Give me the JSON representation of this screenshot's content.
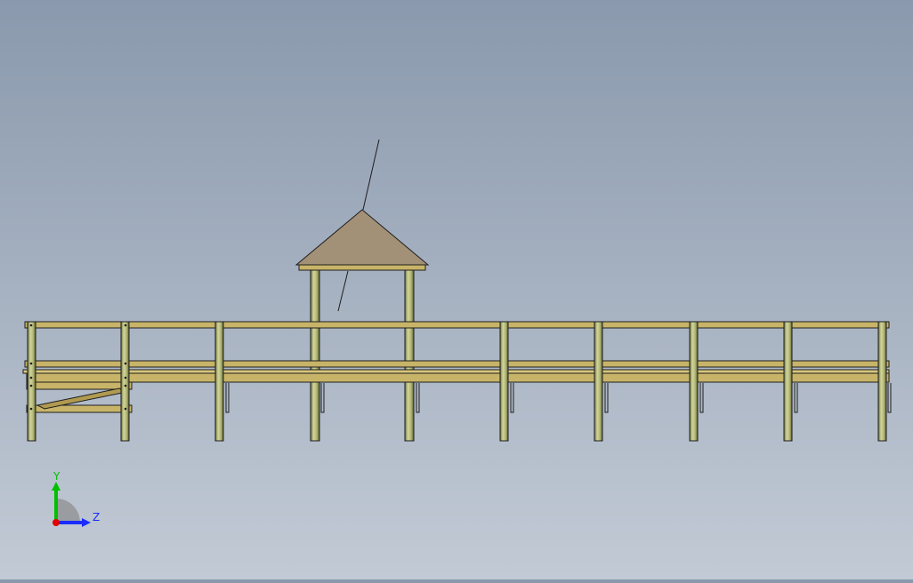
{
  "viewport": {
    "colors": {
      "background_top": "#8a99ad",
      "background_bottom": "#c2cad5",
      "wood": "#c8b468",
      "wood_dark": "#8f7d3c",
      "post": "#b4b878",
      "roof": "#a39177",
      "outline": "#1e1e1e"
    }
  },
  "triad": {
    "y_label": "Y",
    "z_label": "Z",
    "y_color": "#00c000",
    "z_color": "#1a2cff",
    "x_color": "#e00000",
    "icon": "view-orientation-triad-icon"
  }
}
